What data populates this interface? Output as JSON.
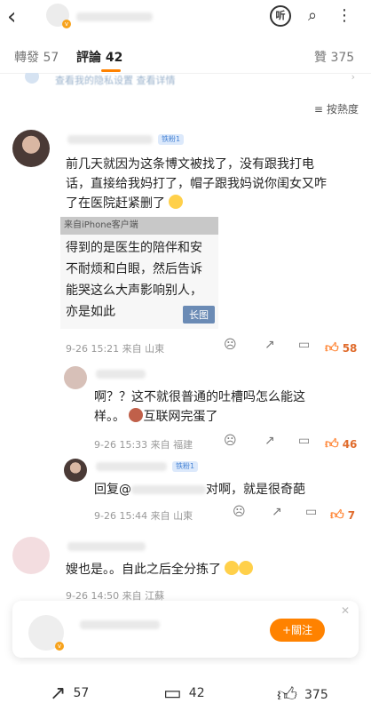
{
  "header": {
    "back_icon": "chevron-left-icon",
    "listen_label": "听",
    "icons": [
      "listen-icon",
      "search-icon",
      "more-icon"
    ]
  },
  "tabs": [
    {
      "label": "轉發 57",
      "active": false
    },
    {
      "label": "評論 42",
      "active": true
    },
    {
      "label": "贊 375",
      "active": false
    }
  ],
  "notice": {
    "text": "查看我的隐私设置 查看详情"
  },
  "sort": {
    "label": "按熱度",
    "icon": "sort-icon"
  },
  "comments": [
    {
      "badge": "铁粉1",
      "text": "前几天就因为这条博文被找了，没有跟我打电话，直接给我妈打了，帽子跟我妈说你闺女又咋了在医院赶紧删了",
      "line1": "前几天就因为这条博文被找了，没有跟我打电",
      "line2": "话，直接给我妈打了，帽子跟我妈说你闺女又咋",
      "line3": "了在医院赶紧删了",
      "image": {
        "ribbon": "来自iPhone客户端",
        "lines": [
          "得到的是医生的陪伴和安",
          "不耐烦和白眼，然后告诉",
          "能哭这么大声影响别人，",
          "亦是如此"
        ],
        "tag": "长图"
      },
      "time": "9-26 15:21 来自 山東",
      "likes": "58"
    },
    {
      "line1": "啊？？这不就很普通的吐槽吗怎么能这",
      "line2a": "样。。",
      "line2b": "互联网完蛋了",
      "time": "9-26 15:33 来自 福建",
      "likes": "46"
    },
    {
      "badge": "铁粉1",
      "prefix": "回复@",
      "suffix": "对啊，就是很奇葩",
      "time": "9-26 15:44 来自 山東",
      "likes": "7"
    },
    {
      "text": "嫂也是。。自此之后全分拣了",
      "time": "9-26 14:50 来自 江蘇",
      "likes": ""
    }
  ],
  "follow_card": {
    "button": "+關注"
  },
  "bottombar": {
    "repost": "57",
    "comment": "42",
    "like": "375"
  },
  "colors": {
    "accent": "#ff8200",
    "like": "#ff8a3d",
    "fan_badge": "#dce9fb"
  }
}
